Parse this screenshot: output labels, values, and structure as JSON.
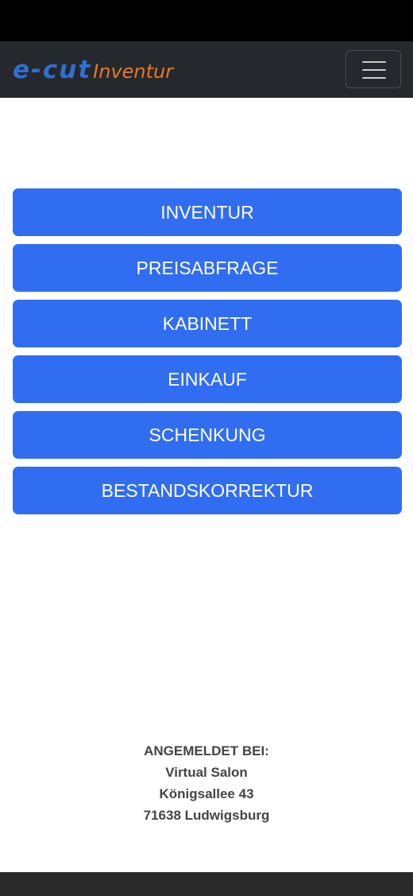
{
  "app": {
    "logo_main": "e-cut",
    "logo_sub": "Inventur"
  },
  "menu": {
    "buttons": [
      "INVENTUR",
      "PREISABFRAGE",
      "KABINETT",
      "EINKAUF",
      "SCHENKUNG",
      "BESTANDSKORREKTUR"
    ]
  },
  "login": {
    "label": "ANGEMELDET BEI:",
    "salon": "Virtual Salon",
    "street": "Königsallee 43",
    "city": "71638 Ludwigsburg"
  },
  "colors": {
    "accent": "#316df1",
    "navbar": "#25282c",
    "logo_blue": "#2f6fd6",
    "logo_orange": "#e6782a"
  },
  "icons": {
    "menu_toggle": "hamburger-menu-icon"
  }
}
